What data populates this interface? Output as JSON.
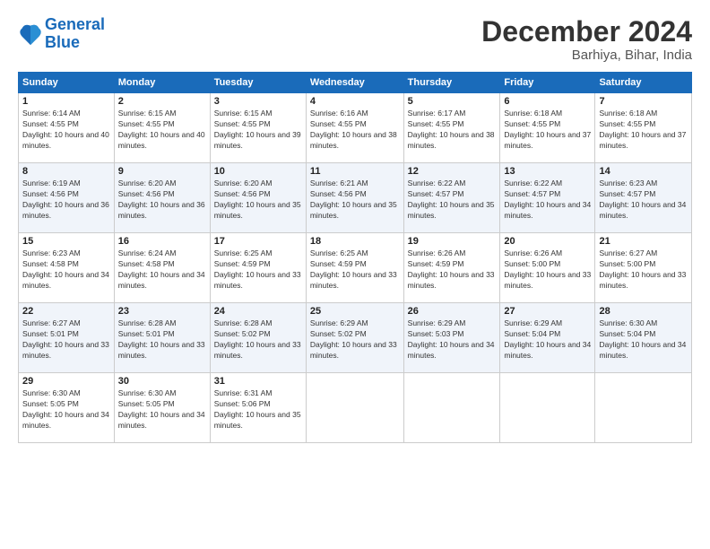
{
  "logo": {
    "line1": "General",
    "line2": "Blue"
  },
  "title": "December 2024",
  "location": "Barhiya, Bihar, India",
  "days_header": [
    "Sunday",
    "Monday",
    "Tuesday",
    "Wednesday",
    "Thursday",
    "Friday",
    "Saturday"
  ],
  "weeks": [
    [
      {
        "day": "1",
        "sunrise": "6:14 AM",
        "sunset": "4:55 PM",
        "daylight": "10 hours and 40 minutes."
      },
      {
        "day": "2",
        "sunrise": "6:15 AM",
        "sunset": "4:55 PM",
        "daylight": "10 hours and 40 minutes."
      },
      {
        "day": "3",
        "sunrise": "6:15 AM",
        "sunset": "4:55 PM",
        "daylight": "10 hours and 39 minutes."
      },
      {
        "day": "4",
        "sunrise": "6:16 AM",
        "sunset": "4:55 PM",
        "daylight": "10 hours and 38 minutes."
      },
      {
        "day": "5",
        "sunrise": "6:17 AM",
        "sunset": "4:55 PM",
        "daylight": "10 hours and 38 minutes."
      },
      {
        "day": "6",
        "sunrise": "6:18 AM",
        "sunset": "4:55 PM",
        "daylight": "10 hours and 37 minutes."
      },
      {
        "day": "7",
        "sunrise": "6:18 AM",
        "sunset": "4:55 PM",
        "daylight": "10 hours and 37 minutes."
      }
    ],
    [
      {
        "day": "8",
        "sunrise": "6:19 AM",
        "sunset": "4:56 PM",
        "daylight": "10 hours and 36 minutes."
      },
      {
        "day": "9",
        "sunrise": "6:20 AM",
        "sunset": "4:56 PM",
        "daylight": "10 hours and 36 minutes."
      },
      {
        "day": "10",
        "sunrise": "6:20 AM",
        "sunset": "4:56 PM",
        "daylight": "10 hours and 35 minutes."
      },
      {
        "day": "11",
        "sunrise": "6:21 AM",
        "sunset": "4:56 PM",
        "daylight": "10 hours and 35 minutes."
      },
      {
        "day": "12",
        "sunrise": "6:22 AM",
        "sunset": "4:57 PM",
        "daylight": "10 hours and 35 minutes."
      },
      {
        "day": "13",
        "sunrise": "6:22 AM",
        "sunset": "4:57 PM",
        "daylight": "10 hours and 34 minutes."
      },
      {
        "day": "14",
        "sunrise": "6:23 AM",
        "sunset": "4:57 PM",
        "daylight": "10 hours and 34 minutes."
      }
    ],
    [
      {
        "day": "15",
        "sunrise": "6:23 AM",
        "sunset": "4:58 PM",
        "daylight": "10 hours and 34 minutes."
      },
      {
        "day": "16",
        "sunrise": "6:24 AM",
        "sunset": "4:58 PM",
        "daylight": "10 hours and 34 minutes."
      },
      {
        "day": "17",
        "sunrise": "6:25 AM",
        "sunset": "4:59 PM",
        "daylight": "10 hours and 33 minutes."
      },
      {
        "day": "18",
        "sunrise": "6:25 AM",
        "sunset": "4:59 PM",
        "daylight": "10 hours and 33 minutes."
      },
      {
        "day": "19",
        "sunrise": "6:26 AM",
        "sunset": "4:59 PM",
        "daylight": "10 hours and 33 minutes."
      },
      {
        "day": "20",
        "sunrise": "6:26 AM",
        "sunset": "5:00 PM",
        "daylight": "10 hours and 33 minutes."
      },
      {
        "day": "21",
        "sunrise": "6:27 AM",
        "sunset": "5:00 PM",
        "daylight": "10 hours and 33 minutes."
      }
    ],
    [
      {
        "day": "22",
        "sunrise": "6:27 AM",
        "sunset": "5:01 PM",
        "daylight": "10 hours and 33 minutes."
      },
      {
        "day": "23",
        "sunrise": "6:28 AM",
        "sunset": "5:01 PM",
        "daylight": "10 hours and 33 minutes."
      },
      {
        "day": "24",
        "sunrise": "6:28 AM",
        "sunset": "5:02 PM",
        "daylight": "10 hours and 33 minutes."
      },
      {
        "day": "25",
        "sunrise": "6:29 AM",
        "sunset": "5:02 PM",
        "daylight": "10 hours and 33 minutes."
      },
      {
        "day": "26",
        "sunrise": "6:29 AM",
        "sunset": "5:03 PM",
        "daylight": "10 hours and 34 minutes."
      },
      {
        "day": "27",
        "sunrise": "6:29 AM",
        "sunset": "5:04 PM",
        "daylight": "10 hours and 34 minutes."
      },
      {
        "day": "28",
        "sunrise": "6:30 AM",
        "sunset": "5:04 PM",
        "daylight": "10 hours and 34 minutes."
      }
    ],
    [
      {
        "day": "29",
        "sunrise": "6:30 AM",
        "sunset": "5:05 PM",
        "daylight": "10 hours and 34 minutes."
      },
      {
        "day": "30",
        "sunrise": "6:30 AM",
        "sunset": "5:05 PM",
        "daylight": "10 hours and 34 minutes."
      },
      {
        "day": "31",
        "sunrise": "6:31 AM",
        "sunset": "5:06 PM",
        "daylight": "10 hours and 35 minutes."
      },
      null,
      null,
      null,
      null
    ]
  ]
}
